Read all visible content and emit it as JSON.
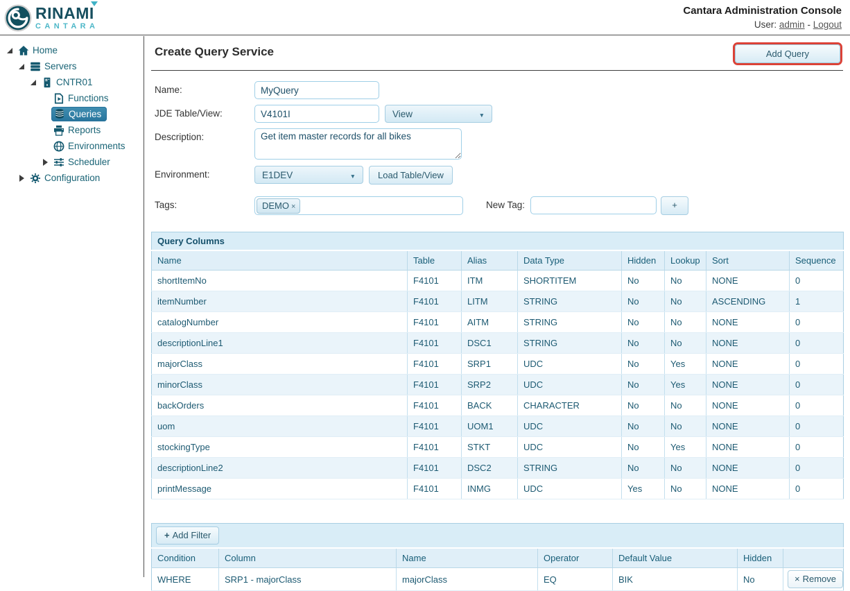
{
  "header": {
    "logo_line1": "RINAMI",
    "logo_line2": "CANTARA",
    "title": "Cantara Administration Console",
    "user_label": "User:",
    "user_name": "admin",
    "user_separator": "-",
    "logout_label": "Logout"
  },
  "sidebar": {
    "items": [
      {
        "label": "Home",
        "icon": "home-icon",
        "level": 0,
        "expander": "expanded",
        "selected": false
      },
      {
        "label": "Servers",
        "icon": "servers-icon",
        "level": 1,
        "expander": "expanded",
        "selected": false
      },
      {
        "label": "CNTR01",
        "icon": "server-icon",
        "level": 2,
        "expander": "expanded",
        "selected": false
      },
      {
        "label": "Functions",
        "icon": "functions-icon",
        "level": 3,
        "expander": "none",
        "selected": false
      },
      {
        "label": "Queries",
        "icon": "queries-icon",
        "level": 3,
        "expander": "none",
        "selected": true
      },
      {
        "label": "Reports",
        "icon": "reports-icon",
        "level": 3,
        "expander": "none",
        "selected": false
      },
      {
        "label": "Environments",
        "icon": "environments-icon",
        "level": 3,
        "expander": "none",
        "selected": false
      },
      {
        "label": "Scheduler",
        "icon": "scheduler-icon",
        "level": 3,
        "expander": "collapsed",
        "selected": false
      },
      {
        "label": "Configuration",
        "icon": "configuration-icon",
        "level": 1,
        "expander": "collapsed",
        "selected": false
      }
    ]
  },
  "main": {
    "page_title": "Create Query Service",
    "add_query_label": "Add Query",
    "form": {
      "name_label": "Name:",
      "name_value": "MyQuery",
      "table_view_label": "JDE Table/View:",
      "table_view_value": "V4101I",
      "table_view_type": "View",
      "description_label": "Description:",
      "description_value": "Get item master records for all bikes",
      "environment_label": "Environment:",
      "environment_value": "E1DEV",
      "load_table_label": "Load Table/View",
      "tags_label": "Tags:",
      "tag_value": "DEMO",
      "tag_remove_glyph": "×",
      "new_tag_label": "New Tag:",
      "new_tag_value": "",
      "add_tag_label": "+"
    },
    "query_columns": {
      "title": "Query Columns",
      "headers": [
        "Name",
        "Table",
        "Alias",
        "Data Type",
        "Hidden",
        "Lookup",
        "Sort",
        "Sequence"
      ],
      "rows": [
        [
          "shortItemNo",
          "F4101",
          "ITM",
          "SHORTITEM",
          "No",
          "No",
          "NONE",
          "0"
        ],
        [
          "itemNumber",
          "F4101",
          "LITM",
          "STRING",
          "No",
          "No",
          "ASCENDING",
          "1"
        ],
        [
          "catalogNumber",
          "F4101",
          "AITM",
          "STRING",
          "No",
          "No",
          "NONE",
          "0"
        ],
        [
          "descriptionLine1",
          "F4101",
          "DSC1",
          "STRING",
          "No",
          "No",
          "NONE",
          "0"
        ],
        [
          "majorClass",
          "F4101",
          "SRP1",
          "UDC",
          "No",
          "Yes",
          "NONE",
          "0"
        ],
        [
          "minorClass",
          "F4101",
          "SRP2",
          "UDC",
          "No",
          "Yes",
          "NONE",
          "0"
        ],
        [
          "backOrders",
          "F4101",
          "BACK",
          "CHARACTER",
          "No",
          "No",
          "NONE",
          "0"
        ],
        [
          "uom",
          "F4101",
          "UOM1",
          "UDC",
          "No",
          "No",
          "NONE",
          "0"
        ],
        [
          "stockingType",
          "F4101",
          "STKT",
          "UDC",
          "No",
          "Yes",
          "NONE",
          "0"
        ],
        [
          "descriptionLine2",
          "F4101",
          "DSC2",
          "STRING",
          "No",
          "No",
          "NONE",
          "0"
        ],
        [
          "printMessage",
          "F4101",
          "INMG",
          "UDC",
          "Yes",
          "No",
          "NONE",
          "0"
        ]
      ]
    },
    "filters": {
      "add_filter_plus_glyph": "+",
      "add_filter_label": "Add Filter",
      "headers": [
        "Condition",
        "Column",
        "Name",
        "Operator",
        "Default Value",
        "Hidden",
        ""
      ],
      "rows": [
        {
          "cells": [
            "WHERE",
            "SRP1 - majorClass",
            "majorClass",
            "EQ",
            "BIK",
            "No"
          ],
          "remove_glyph": "×",
          "remove_label": "Remove"
        }
      ]
    }
  },
  "colors": {
    "accent_teal_text": "#1a6476",
    "selected_item_blue": "#2e81a6",
    "panel_blue": "#d9edf7",
    "highlight_red": "#dc4237",
    "link_gray": "#555555"
  }
}
